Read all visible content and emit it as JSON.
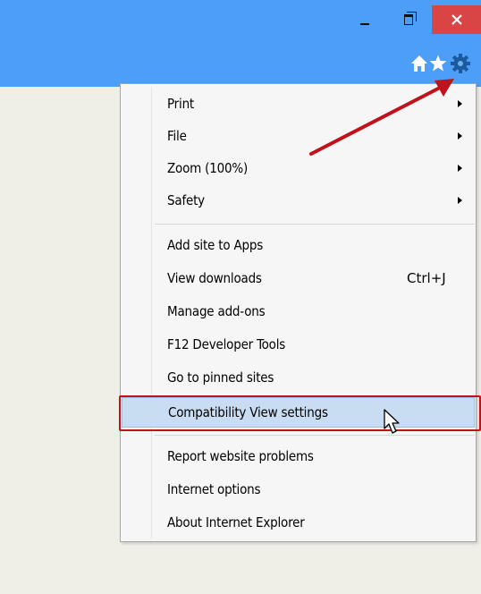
{
  "window": {
    "title_buttons": {
      "minimize_icon": "minimize-icon",
      "maximize_icon": "restore-icon",
      "close_icon": "close-icon"
    },
    "close_color": "#d94545",
    "bar_color": "#4c9ef6",
    "toolbar_icons": [
      "home-icon",
      "star-icon",
      "gear-icon"
    ]
  },
  "menu": {
    "groups": [
      {
        "items": [
          {
            "label": "Print",
            "submenu": true
          },
          {
            "label": "File",
            "submenu": true
          },
          {
            "label": "Zoom (100%)",
            "submenu": true
          },
          {
            "label": "Safety",
            "submenu": true
          }
        ]
      },
      {
        "items": [
          {
            "label": "Add site to Apps"
          },
          {
            "label": "View downloads",
            "shortcut": "Ctrl+J"
          },
          {
            "label": "Manage add-ons"
          },
          {
            "label": "F12 Developer Tools"
          },
          {
            "label": "Go to pinned sites"
          },
          {
            "label": "Compatibility View settings",
            "highlighted": true
          }
        ]
      },
      {
        "items": [
          {
            "label": "Report website problems"
          },
          {
            "label": "Internet options"
          },
          {
            "label": "About Internet Explorer"
          }
        ]
      }
    ],
    "highlight_color": "#c9ddf2",
    "annotation_color": "#c0121a"
  }
}
